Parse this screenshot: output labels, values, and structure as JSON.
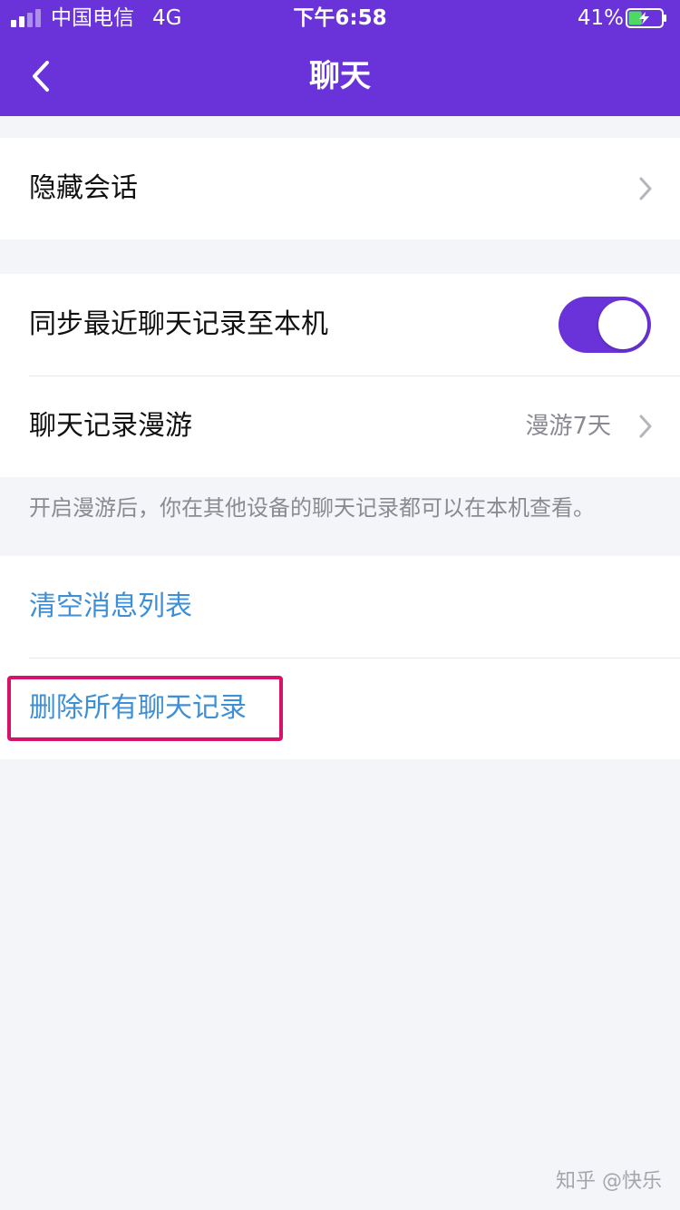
{
  "status_bar": {
    "carrier": "中国电信",
    "network": "4G",
    "time": "下午6:58",
    "battery_percent": "41%",
    "battery_level": 0.41,
    "signal_icon": "signal-bars-icon",
    "battery_icon": "battery-charging-icon"
  },
  "nav": {
    "title": "聊天",
    "back_icon": "chevron-left-icon"
  },
  "groups": {
    "hidden": {
      "label": "隐藏会话"
    },
    "sync": {
      "label": "同步最近聊天记录至本机",
      "enabled": true
    },
    "roaming": {
      "label": "聊天记录漫游",
      "value": "漫游7天"
    },
    "hint": "开启漫游后，你在其他设备的聊天记录都可以在本机查看。",
    "clear": {
      "label": "清空消息列表"
    },
    "delete": {
      "label": "删除所有聊天记录"
    }
  },
  "watermark": "知乎 @快乐",
  "colors": {
    "brand": "#6933d9",
    "link": "#3e8fd6",
    "highlight": "#d6136b",
    "battery_fill": "#4cd964"
  }
}
